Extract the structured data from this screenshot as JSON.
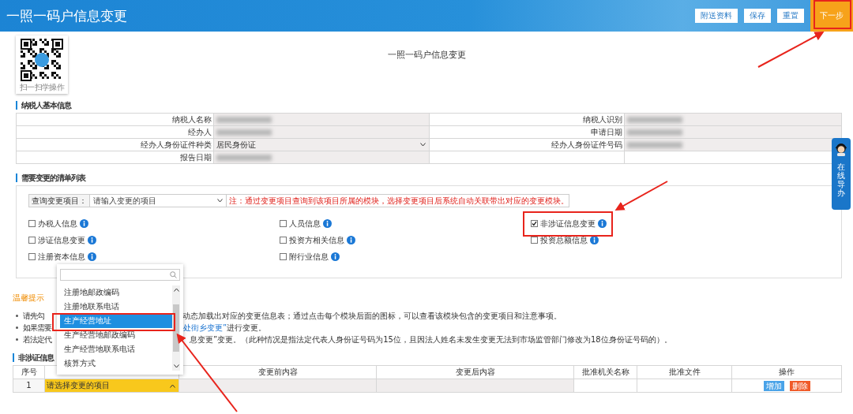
{
  "header": {
    "title": "一照一码户信息变更",
    "buttons": [
      {
        "label": "附送资料",
        "kind": "plain"
      },
      {
        "label": "保存",
        "kind": "plain"
      },
      {
        "label": "重置",
        "kind": "plain"
      },
      {
        "label": "下一步",
        "kind": "primary"
      }
    ]
  },
  "qr": {
    "caption": "扫一扫学操作"
  },
  "page_title": "一照一码户信息变更",
  "basic_info": {
    "heading": "纳税人基本信息",
    "fields": [
      {
        "label": "纳税人名称",
        "kind": "blurred"
      },
      {
        "label": "纳税人识别",
        "kind": "blurred"
      },
      {
        "label": "经办人",
        "kind": "blurred"
      },
      {
        "label": "申请日期",
        "kind": "blurred"
      },
      {
        "label": "经办人身份证件种类",
        "kind": "select",
        "value": "居民身份证"
      },
      {
        "label": "经办人身份证件号码",
        "kind": "blurred"
      },
      {
        "label": "报告日期",
        "kind": "blurred"
      }
    ]
  },
  "change_list": {
    "heading": "需要变更的清单列表",
    "query": {
      "label": "查询变更项目：",
      "placeholder": "请输入变更的项目",
      "note": "注：通过变更项目查询到该项目所属的模块，选择变更项目后系统自动关联带出对应的变更模块。"
    },
    "options": [
      {
        "label": "办税人信息",
        "checked": false
      },
      {
        "label": "人员信息",
        "checked": false
      },
      {
        "label": "非涉证信息变更",
        "checked": true
      },
      {
        "label": "涉证信息变更",
        "checked": false
      },
      {
        "label": "投资方相关信息",
        "checked": false
      },
      {
        "label": "投资总额信息",
        "checked": false
      },
      {
        "label": "注册资本信息",
        "checked": false
      },
      {
        "label": "附行业信息",
        "checked": false
      }
    ]
  },
  "tips": {
    "title": "温馨提示",
    "notes": [
      {
        "before": "请先勾",
        "after": "动态加载出对应的变更信息表；通过点击每个模块后面的图标，可以查看该模块包含的变更项目和注意事项。"
      },
      {
        "before": "如果需要",
        "link": "处街乡变更”",
        "after": "进行变更。"
      },
      {
        "before": "若法定代",
        "after": "息变更”变更。（此种情况是指法定代表人身份证号码为15位，且因法人姓名未发生变更无法到市场监管部门修改为18位身份证号码的）。"
      }
    ]
  },
  "detail": {
    "heading": "非涉证信息",
    "columns": [
      "序号",
      "变更前内容",
      "变更后内容",
      "批准机关名称",
      "批准文件",
      "操作"
    ],
    "rows": [
      {
        "index": "1",
        "select": "请选择变更的项目",
        "actions": [
          {
            "label": "增加",
            "kind": "add"
          },
          {
            "label": "删除",
            "kind": "delete"
          }
        ]
      }
    ]
  },
  "dropdown": {
    "items": [
      {
        "label": "注册地邮政编码",
        "selected": false
      },
      {
        "label": "注册地联系电话",
        "selected": false
      },
      {
        "label": "生产经营地址",
        "selected": true
      },
      {
        "label": "生产经营地邮政编码",
        "selected": false
      },
      {
        "label": "生产经营地联系电话",
        "selected": false
      },
      {
        "label": "核算方式",
        "selected": false
      }
    ]
  },
  "help": {
    "label": "在线导办"
  }
}
